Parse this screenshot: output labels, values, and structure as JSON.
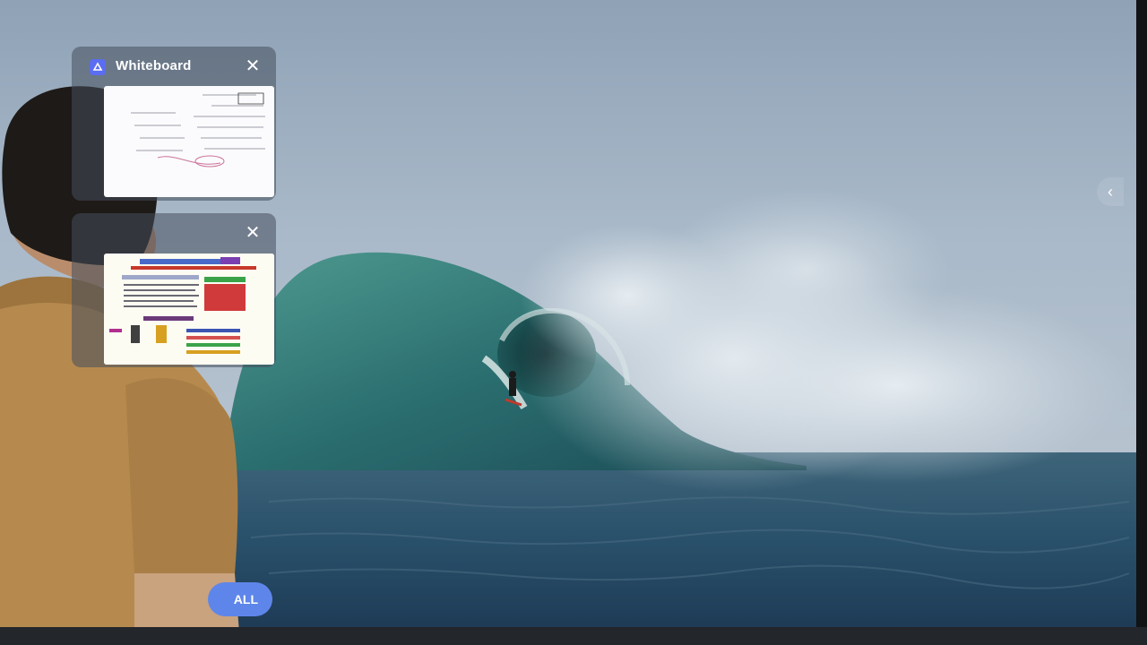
{
  "background": {
    "subject": "surfer-wave-wallpaper",
    "sky_color": "#9eafc1",
    "wave_color": "#2f7f7c",
    "sea_color": "#2a4d66"
  },
  "task_switcher": {
    "cards": [
      {
        "title": "Whiteboard",
        "icon": "whiteboard-app-icon",
        "close_icon": "close-icon"
      },
      {
        "title": "",
        "icon": "",
        "close_icon": "close-icon"
      }
    ],
    "clear_all_label": "ALL"
  },
  "side_panel": {
    "toggle_icon": "chevron-left-icon",
    "toggle_glyph": "‹"
  },
  "presenter": {
    "shirt_color": "#b68a4e"
  }
}
